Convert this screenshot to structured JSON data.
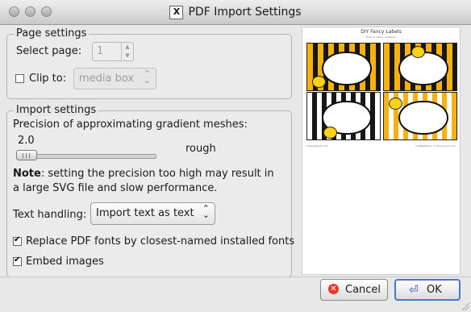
{
  "window": {
    "title": "PDF Import Settings",
    "app_icon_glyph": "X"
  },
  "page_settings": {
    "group_title": "Page settings",
    "select_page_label": "Select page:",
    "select_page_value": "1",
    "clip_to_label": "Clip to:",
    "clip_to_checked": false,
    "clip_to_value": "media box"
  },
  "import_settings": {
    "group_title": "Import settings",
    "precision_label": "Precision of approximating gradient meshes:",
    "precision_value": "2.0",
    "precision_fraction": 0.0,
    "precision_desc": "rough",
    "note_bold": "Note",
    "note_line1": ": setting the precision too high may result in",
    "note_line2": "a large SVG file and slow performance.",
    "text_handling_label": "Text handling:",
    "text_handling_value": "Import text as text",
    "replace_fonts_label": "Replace PDF fonts by closest-named installed fonts",
    "replace_fonts_checked": true,
    "embed_images_label": "Embed images",
    "embed_images_checked": true
  },
  "preview": {
    "title": "DIY Fancy Labels",
    "subtitle": "Print on heavy cardstock",
    "footer_left": "www.website.com",
    "footer_right": "FreeBeeFancy © fancyname.com"
  },
  "buttons": {
    "cancel": "Cancel",
    "ok": "OK"
  },
  "colors": {
    "accent": "#4b78c3",
    "stripe_yellow": "#f7b20f",
    "stripe_black": "#171717",
    "cancel_red": "#e23b2a"
  }
}
